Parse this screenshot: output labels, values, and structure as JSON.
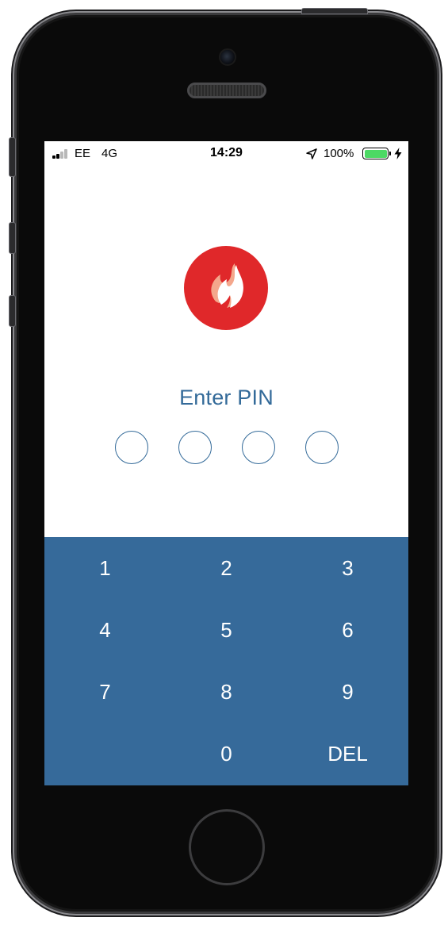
{
  "status_bar": {
    "carrier": "EE",
    "network": "4G",
    "time": "14:29",
    "battery_percent": "100%",
    "icons": [
      "signal-icon",
      "location-icon",
      "battery-icon",
      "charging-bolt-icon"
    ]
  },
  "logo": {
    "icon": "flame-logo-icon",
    "color": "#e0282a"
  },
  "pin": {
    "title": "Enter PIN",
    "length": 4,
    "entered": 0
  },
  "keypad": {
    "keys": [
      "1",
      "2",
      "3",
      "4",
      "5",
      "6",
      "7",
      "8",
      "9",
      "",
      "0",
      "DEL"
    ],
    "background": "#366a9a"
  },
  "colors": {
    "accent": "#336a99",
    "keypad": "#366a9a",
    "logo": "#e0282a"
  }
}
